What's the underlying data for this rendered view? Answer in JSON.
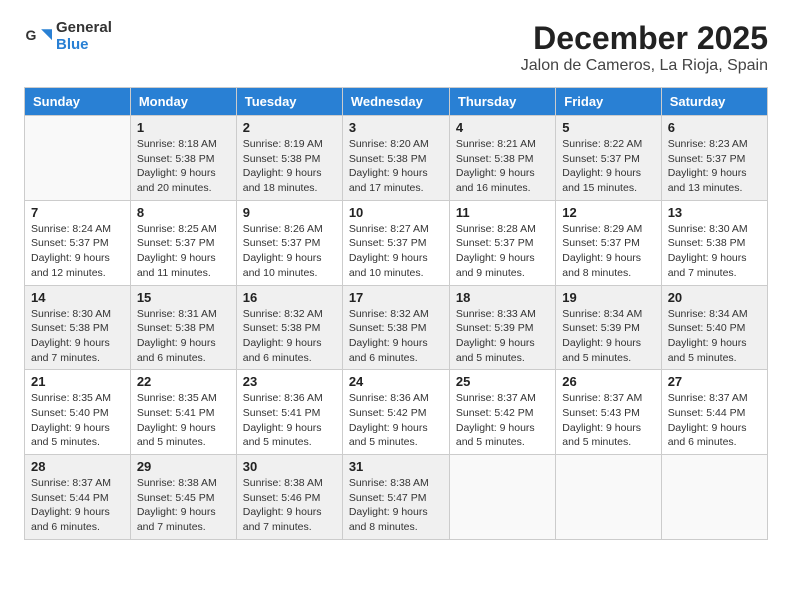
{
  "logo": {
    "line1": "General",
    "line2": "Blue"
  },
  "title": "December 2025",
  "subtitle": "Jalon de Cameros, La Rioja, Spain",
  "weekdays": [
    "Sunday",
    "Monday",
    "Tuesday",
    "Wednesday",
    "Thursday",
    "Friday",
    "Saturday"
  ],
  "weeks": [
    [
      {
        "day": "",
        "info": ""
      },
      {
        "day": "1",
        "info": "Sunrise: 8:18 AM\nSunset: 5:38 PM\nDaylight: 9 hours\nand 20 minutes."
      },
      {
        "day": "2",
        "info": "Sunrise: 8:19 AM\nSunset: 5:38 PM\nDaylight: 9 hours\nand 18 minutes."
      },
      {
        "day": "3",
        "info": "Sunrise: 8:20 AM\nSunset: 5:38 PM\nDaylight: 9 hours\nand 17 minutes."
      },
      {
        "day": "4",
        "info": "Sunrise: 8:21 AM\nSunset: 5:38 PM\nDaylight: 9 hours\nand 16 minutes."
      },
      {
        "day": "5",
        "info": "Sunrise: 8:22 AM\nSunset: 5:37 PM\nDaylight: 9 hours\nand 15 minutes."
      },
      {
        "day": "6",
        "info": "Sunrise: 8:23 AM\nSunset: 5:37 PM\nDaylight: 9 hours\nand 13 minutes."
      }
    ],
    [
      {
        "day": "7",
        "info": "Sunrise: 8:24 AM\nSunset: 5:37 PM\nDaylight: 9 hours\nand 12 minutes."
      },
      {
        "day": "8",
        "info": "Sunrise: 8:25 AM\nSunset: 5:37 PM\nDaylight: 9 hours\nand 11 minutes."
      },
      {
        "day": "9",
        "info": "Sunrise: 8:26 AM\nSunset: 5:37 PM\nDaylight: 9 hours\nand 10 minutes."
      },
      {
        "day": "10",
        "info": "Sunrise: 8:27 AM\nSunset: 5:37 PM\nDaylight: 9 hours\nand 10 minutes."
      },
      {
        "day": "11",
        "info": "Sunrise: 8:28 AM\nSunset: 5:37 PM\nDaylight: 9 hours\nand 9 minutes."
      },
      {
        "day": "12",
        "info": "Sunrise: 8:29 AM\nSunset: 5:37 PM\nDaylight: 9 hours\nand 8 minutes."
      },
      {
        "day": "13",
        "info": "Sunrise: 8:30 AM\nSunset: 5:38 PM\nDaylight: 9 hours\nand 7 minutes."
      }
    ],
    [
      {
        "day": "14",
        "info": "Sunrise: 8:30 AM\nSunset: 5:38 PM\nDaylight: 9 hours\nand 7 minutes."
      },
      {
        "day": "15",
        "info": "Sunrise: 8:31 AM\nSunset: 5:38 PM\nDaylight: 9 hours\nand 6 minutes."
      },
      {
        "day": "16",
        "info": "Sunrise: 8:32 AM\nSunset: 5:38 PM\nDaylight: 9 hours\nand 6 minutes."
      },
      {
        "day": "17",
        "info": "Sunrise: 8:32 AM\nSunset: 5:38 PM\nDaylight: 9 hours\nand 6 minutes."
      },
      {
        "day": "18",
        "info": "Sunrise: 8:33 AM\nSunset: 5:39 PM\nDaylight: 9 hours\nand 5 minutes."
      },
      {
        "day": "19",
        "info": "Sunrise: 8:34 AM\nSunset: 5:39 PM\nDaylight: 9 hours\nand 5 minutes."
      },
      {
        "day": "20",
        "info": "Sunrise: 8:34 AM\nSunset: 5:40 PM\nDaylight: 9 hours\nand 5 minutes."
      }
    ],
    [
      {
        "day": "21",
        "info": "Sunrise: 8:35 AM\nSunset: 5:40 PM\nDaylight: 9 hours\nand 5 minutes."
      },
      {
        "day": "22",
        "info": "Sunrise: 8:35 AM\nSunset: 5:41 PM\nDaylight: 9 hours\nand 5 minutes."
      },
      {
        "day": "23",
        "info": "Sunrise: 8:36 AM\nSunset: 5:41 PM\nDaylight: 9 hours\nand 5 minutes."
      },
      {
        "day": "24",
        "info": "Sunrise: 8:36 AM\nSunset: 5:42 PM\nDaylight: 9 hours\nand 5 minutes."
      },
      {
        "day": "25",
        "info": "Sunrise: 8:37 AM\nSunset: 5:42 PM\nDaylight: 9 hours\nand 5 minutes."
      },
      {
        "day": "26",
        "info": "Sunrise: 8:37 AM\nSunset: 5:43 PM\nDaylight: 9 hours\nand 5 minutes."
      },
      {
        "day": "27",
        "info": "Sunrise: 8:37 AM\nSunset: 5:44 PM\nDaylight: 9 hours\nand 6 minutes."
      }
    ],
    [
      {
        "day": "28",
        "info": "Sunrise: 8:37 AM\nSunset: 5:44 PM\nDaylight: 9 hours\nand 6 minutes."
      },
      {
        "day": "29",
        "info": "Sunrise: 8:38 AM\nSunset: 5:45 PM\nDaylight: 9 hours\nand 7 minutes."
      },
      {
        "day": "30",
        "info": "Sunrise: 8:38 AM\nSunset: 5:46 PM\nDaylight: 9 hours\nand 7 minutes."
      },
      {
        "day": "31",
        "info": "Sunrise: 8:38 AM\nSunset: 5:47 PM\nDaylight: 9 hours\nand 8 minutes."
      },
      {
        "day": "",
        "info": ""
      },
      {
        "day": "",
        "info": ""
      },
      {
        "day": "",
        "info": ""
      }
    ]
  ]
}
